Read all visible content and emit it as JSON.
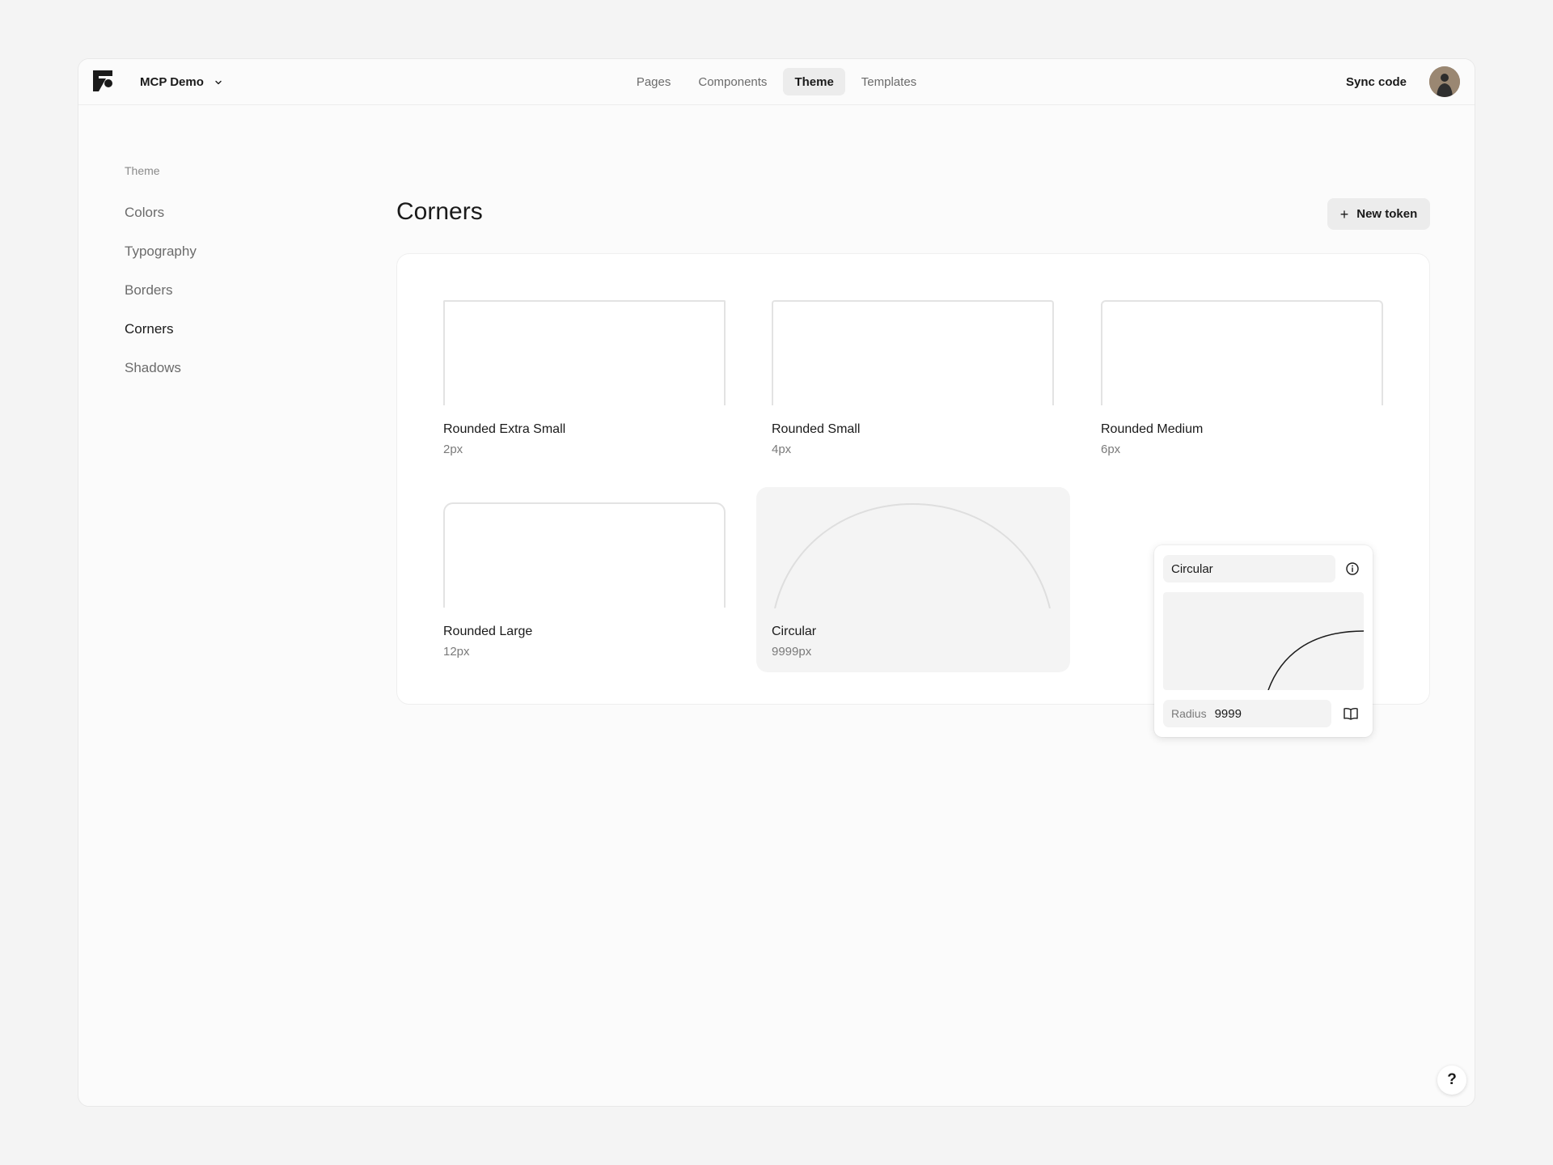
{
  "header": {
    "project_name": "MCP Demo",
    "nav": [
      {
        "label": "Pages",
        "active": false
      },
      {
        "label": "Components",
        "active": false
      },
      {
        "label": "Theme",
        "active": true
      },
      {
        "label": "Templates",
        "active": false
      }
    ],
    "sync_label": "Sync code"
  },
  "sidebar": {
    "title": "Theme",
    "items": [
      {
        "label": "Colors",
        "active": false
      },
      {
        "label": "Typography",
        "active": false
      },
      {
        "label": "Borders",
        "active": false
      },
      {
        "label": "Corners",
        "active": true
      },
      {
        "label": "Shadows",
        "active": false
      }
    ]
  },
  "main": {
    "title": "Corners",
    "new_token_label": "New token",
    "tokens": [
      {
        "name": "Rounded Extra Small",
        "value": "2px"
      },
      {
        "name": "Rounded Small",
        "value": "4px"
      },
      {
        "name": "Rounded Medium",
        "value": "6px"
      },
      {
        "name": "Rounded Large",
        "value": "12px"
      },
      {
        "name": "Circular",
        "value": "9999px"
      }
    ]
  },
  "editor": {
    "name_value": "Circular",
    "radius_label": "Radius",
    "radius_value": "9999"
  },
  "help_label": "?",
  "icons": [
    "logo-icon",
    "chevron-down-icon",
    "plus-icon",
    "info-icon",
    "book-icon",
    "avatar"
  ]
}
